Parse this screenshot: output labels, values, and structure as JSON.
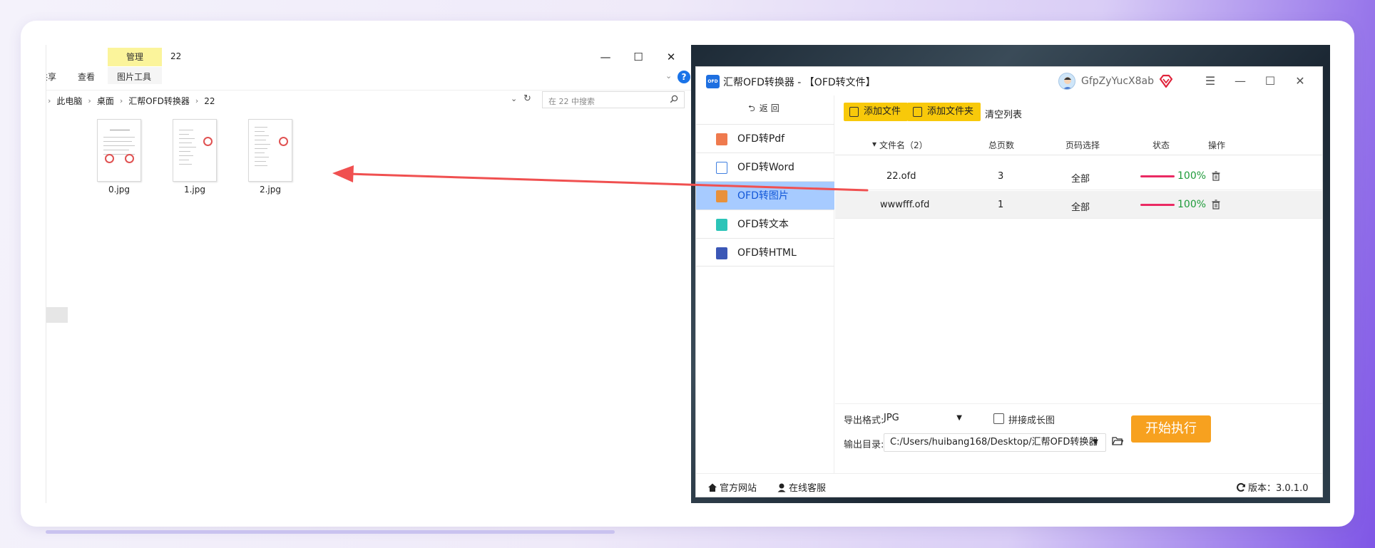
{
  "explorer": {
    "ribbon_tab_manage": "管理",
    "folder_title": "22",
    "ribbon_share": "共享",
    "ribbon_view": "查看",
    "ribbon_picture_tools": "图片工具",
    "window_minimize": "—",
    "window_maximize": "☐",
    "window_close": "✕",
    "help": "?",
    "breadcrumbs": [
      "此电脑",
      "桌面",
      "汇帮OFD转换器",
      "22"
    ],
    "search_placeholder": "在 22 中搜索",
    "files": [
      {
        "name": "0.jpg"
      },
      {
        "name": "1.jpg"
      },
      {
        "name": "2.jpg"
      }
    ]
  },
  "app": {
    "logo_text": "OFD",
    "title": "汇帮OFD转换器 - 【OFD转文件】",
    "username": "GfpZyYucX8ab",
    "back_label": "返回",
    "nav": [
      {
        "label": "OFD转Pdf",
        "color": "#ef7a4e"
      },
      {
        "label": "OFD转Word",
        "color": "#3f7fe0"
      },
      {
        "label": "OFD转图片",
        "color": "#e8913b",
        "active": true
      },
      {
        "label": "OFD转文本",
        "color": "#2cc4b8"
      },
      {
        "label": "OFD转HTML",
        "color": "#3b57b6"
      }
    ],
    "toolbar": {
      "add_file": "添加文件",
      "add_folder": "添加文件夹",
      "clear_list": "清空列表"
    },
    "table": {
      "headers": [
        "文件名（2）",
        "总页数",
        "页码选择",
        "状态",
        "操作"
      ],
      "rows": [
        {
          "name": "22.ofd",
          "pages": "3",
          "range": "全部",
          "status": "100%"
        },
        {
          "name": "wwwfff.ofd",
          "pages": "1",
          "range": "全部",
          "status": "100%"
        }
      ]
    },
    "export_format_label": "导出格式:",
    "export_format_value": "JPG",
    "merge_label": "拼接成长图",
    "output_dir_label": "输出目录:",
    "output_dir_value": "C:/Users/huibang168/Desktop/汇帮OFD转换器",
    "start_button": "开始执行",
    "status_bar": {
      "website": "官方网站",
      "support": "在线客服",
      "version": "版本：3.0.1.0"
    },
    "colors": {
      "accent_yellow": "#f8c90a",
      "start_orange": "#f7a11f",
      "nav_active_bg": "#a7cbff",
      "progress": "#ea2a63",
      "status_green": "#1e9b3a",
      "arrow": "#f05050"
    }
  }
}
